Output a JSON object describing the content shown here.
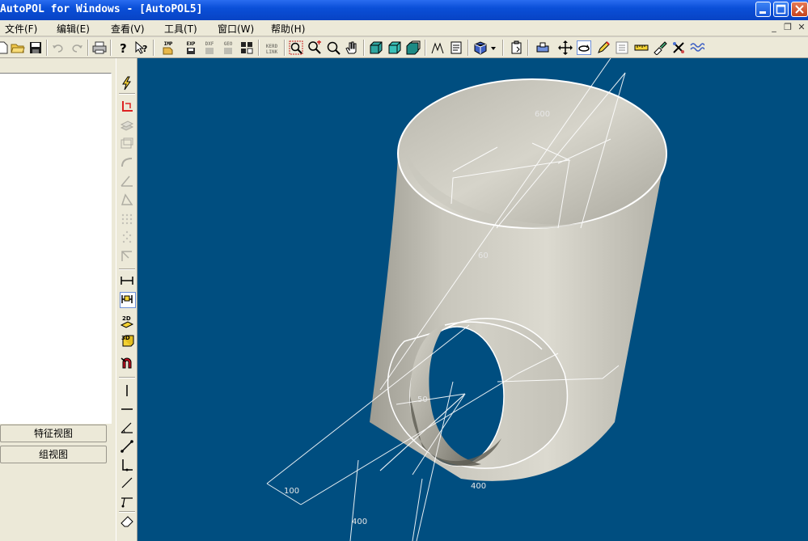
{
  "window": {
    "title": "AutoPOL for Windows - [AutoPOL5]"
  },
  "menu": {
    "items": [
      {
        "label": "文件(F)",
        "name": "menu-file"
      },
      {
        "label": "编辑(E)",
        "name": "menu-edit"
      },
      {
        "label": "查看(V)",
        "name": "menu-view"
      },
      {
        "label": "工具(T)",
        "name": "menu-tools"
      },
      {
        "label": "窗口(W)",
        "name": "menu-window"
      },
      {
        "label": "帮助(H)",
        "name": "menu-help"
      }
    ]
  },
  "toolbar": {
    "imp_label": "IMP",
    "exp_label": "EXP",
    "dxf_label": "DXF",
    "geo_label": "GEO",
    "kerd_label": "KERD LINK"
  },
  "left_panel": {
    "feature_view_button": "特征视图",
    "group_view_button": "组视图"
  },
  "vertical_toolbar": {
    "view2d_label": "2D",
    "view3d_label": "3D"
  },
  "viewport": {
    "dimension_labels": [
      "600",
      "60",
      "50",
      "100",
      "400",
      "400"
    ]
  },
  "colors": {
    "viewport_bg": "#004e80",
    "titlebar_blue": "#0a4fd8",
    "chrome_bg": "#ece9d8",
    "pipe_light": "#d8d6cc",
    "pipe_dark": "#7c7a70"
  }
}
